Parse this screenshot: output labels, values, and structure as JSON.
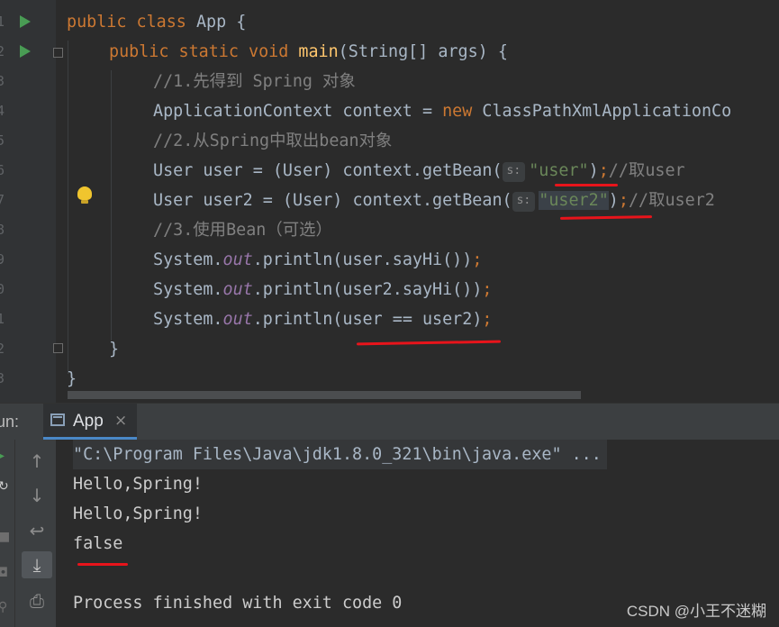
{
  "editor": {
    "line_numbers": [
      "1",
      "2",
      "3",
      "4",
      "5",
      "6",
      "7",
      "8",
      "9",
      "0",
      "1",
      "2",
      "3"
    ],
    "lines": {
      "l1": {
        "k1": "public class ",
        "name": "App",
        "rest": " {"
      },
      "l2": {
        "k1": "public static void ",
        "fn": "main",
        "rest": "(String[] args) {"
      },
      "l3": {
        "comment": "//1.先得到 Spring 对象"
      },
      "l4": {
        "a": "ApplicationContext context = ",
        "kw": "new ",
        "b": "ClassPathXmlApplicationCo"
      },
      "l5": {
        "comment": "//2.从Spring中取出bean对象"
      },
      "l6": {
        "a": "User user = (User) context.getBean(",
        "hint": "s:",
        "str": "\"user\"",
        "b": ")",
        "semi": ";",
        "comment": "//取user"
      },
      "l7": {
        "a": "User user2 = (User) context.getBean(",
        "hint": "s:",
        "str": "\"user2\"",
        "b": ")",
        "semi": ";",
        "comment": "//取user2"
      },
      "l8": {
        "comment": "//3.使用Bean（可选）"
      },
      "l9": {
        "a": "System.",
        "fld": "out",
        "b": ".println(user.sayHi())",
        "semi": ";"
      },
      "l10": {
        "a": "System.",
        "fld": "out",
        "b": ".println(user2.sayHi())",
        "semi": ";"
      },
      "l11": {
        "a": "System.",
        "fld": "out",
        "b": ".println(user == user2)",
        "semi": ";"
      },
      "l12": {
        "a": "}"
      },
      "l13": {
        "a": "}"
      }
    },
    "colors": {
      "keyword": "#cc7832",
      "function": "#ffc66d",
      "comment": "#808080",
      "string": "#6a8759",
      "field": "#9876aa",
      "text": "#a9b7c6",
      "underline": "#e8141b"
    }
  },
  "run_panel": {
    "label": "un:",
    "tab_label": "App",
    "tab_close": "×",
    "output": [
      "\"C:\\Program Files\\Java\\jdk1.8.0_321\\bin\\java.exe\" ...",
      "Hello,Spring!",
      "Hello,Spring!",
      "false",
      "",
      "Process finished with exit code 0"
    ],
    "toolbar_icons": [
      "arrow-up-icon",
      "arrow-down-icon",
      "soft-wrap-icon",
      "scroll-to-end-icon",
      "print-icon",
      "trash-icon"
    ]
  },
  "watermark": "CSDN @小王不迷糊"
}
